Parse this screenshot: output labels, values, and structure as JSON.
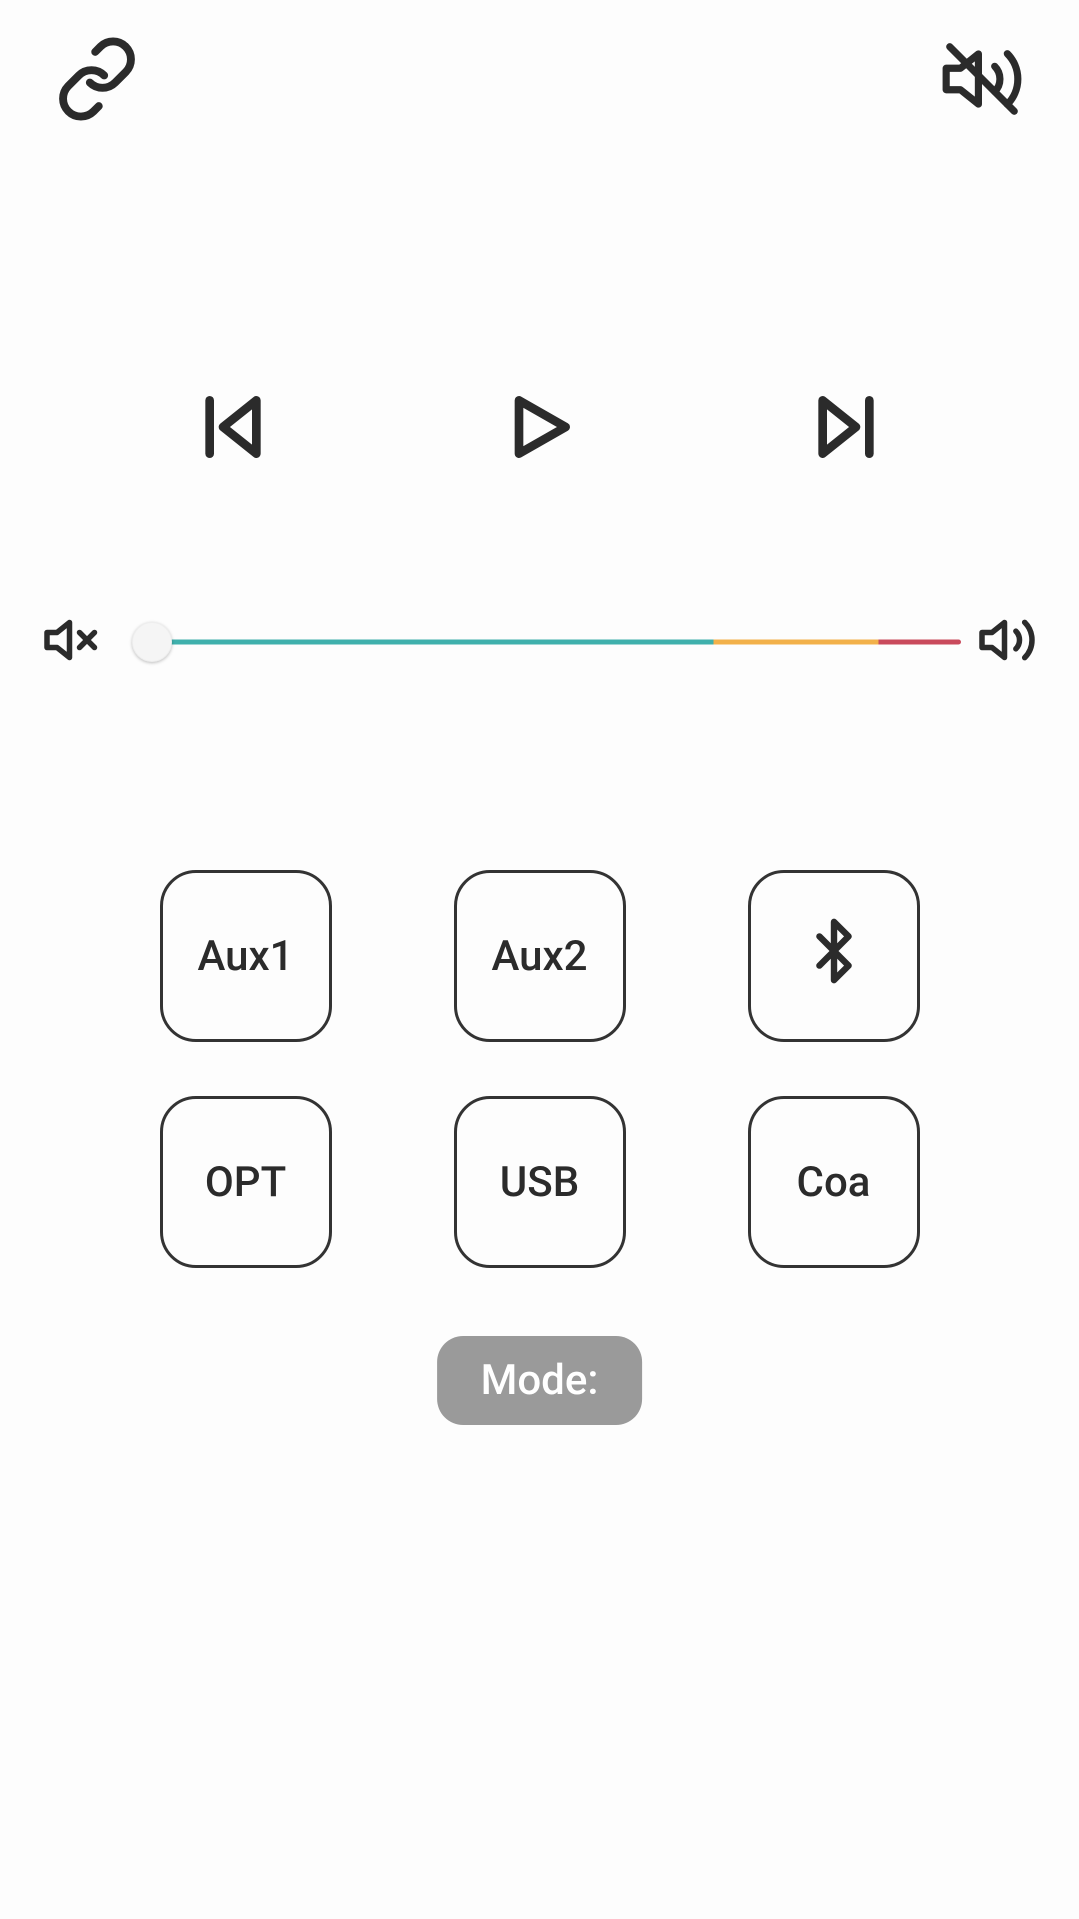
{
  "header": {
    "link_icon": "link-icon",
    "mute_icon": "volume-mute-slash-icon"
  },
  "playback": {
    "prev_icon": "previous-track-icon",
    "play_icon": "play-icon",
    "next_icon": "next-track-icon"
  },
  "volume": {
    "min_icon": "volume-off-icon",
    "max_icon": "volume-high-icon",
    "value_percent": 4,
    "colors": {
      "low": "#3fb0ac",
      "mid": "#f2b14a",
      "high": "#c94a5c"
    }
  },
  "sources": [
    {
      "label": "Aux1",
      "name": "source-aux1"
    },
    {
      "label": "Aux2",
      "name": "source-aux2"
    },
    {
      "icon": "bluetooth-icon",
      "name": "source-bluetooth"
    },
    {
      "label": "OPT",
      "name": "source-opt"
    },
    {
      "label": "USB",
      "name": "source-usb"
    },
    {
      "label": "Coa",
      "name": "source-coa"
    }
  ],
  "mode": {
    "label": "Mode:"
  }
}
